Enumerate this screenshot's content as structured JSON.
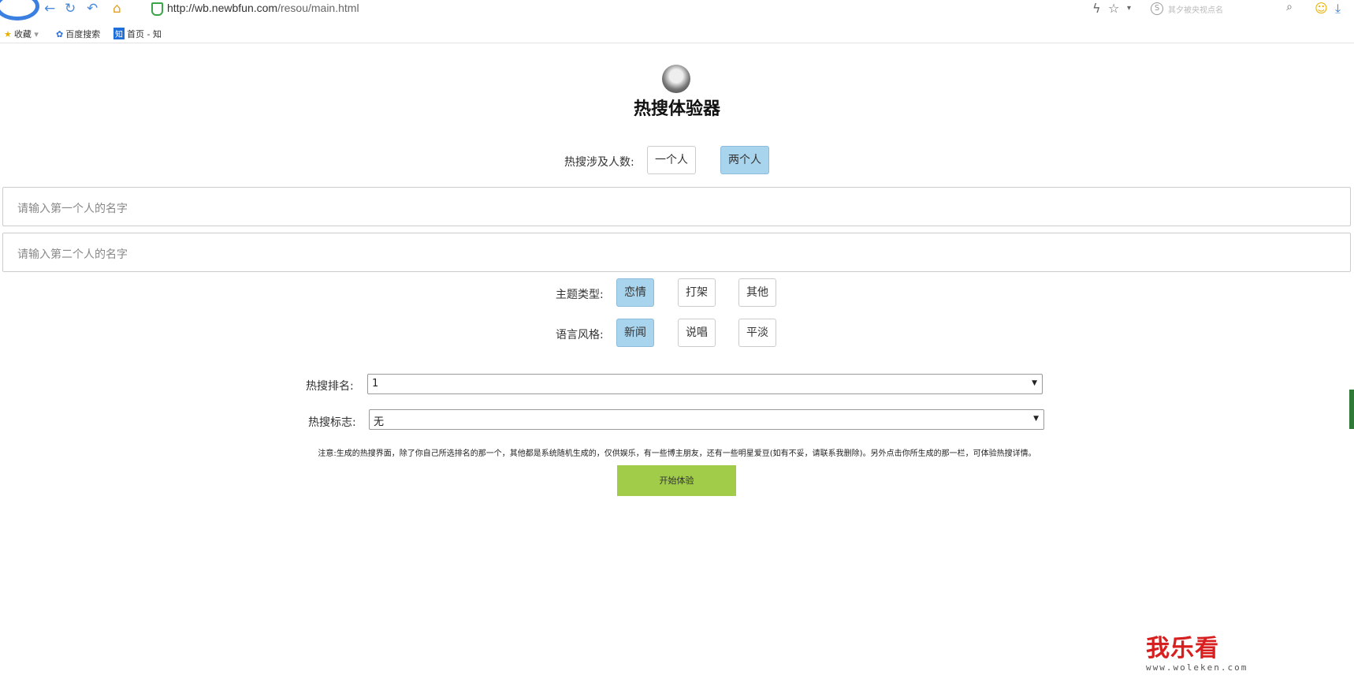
{
  "browser": {
    "url_host": "http://wb.newbfun.com",
    "url_path": "/resou/main.html",
    "search_placeholder": "其夕被央视点名",
    "bookmarks": [
      {
        "label": "收藏"
      },
      {
        "label": "百度搜索"
      },
      {
        "label": "首页 - 知"
      }
    ]
  },
  "page": {
    "title": "热搜体验器",
    "people_label": "热搜涉及人数:",
    "people_options": [
      "一个人",
      "两个人"
    ],
    "people_selected": "两个人",
    "name1_placeholder": "请输入第一个人的名字",
    "name2_placeholder": "请输入第二个人的名字",
    "topic_label": "主题类型:",
    "topic_options": [
      "恋情",
      "打架",
      "其他"
    ],
    "topic_selected": "恋情",
    "style_label": "语言风格:",
    "style_options": [
      "新闻",
      "说唱",
      "平淡"
    ],
    "style_selected": "新闻",
    "rank_label": "热搜排名:",
    "rank_value": "1",
    "mark_label": "热搜标志:",
    "mark_value": "无",
    "note": "注意:生成的热搜界面，除了你自己所选排名的那一个，其他都是系统随机生成的，仅供娱乐，有一些博主朋友，还有一些明星爱豆(如有不妥，请联系我删除)。另外点击你所生成的那一栏，可体验热搜详情。",
    "start_button": "开始体验"
  },
  "watermark": {
    "main": "我乐看",
    "sub": "www.woleken.com"
  },
  "colors": {
    "selected_option": "#a9d4ee",
    "start_button": "#a0cc4a",
    "watermark_red": "#d81f1f"
  }
}
